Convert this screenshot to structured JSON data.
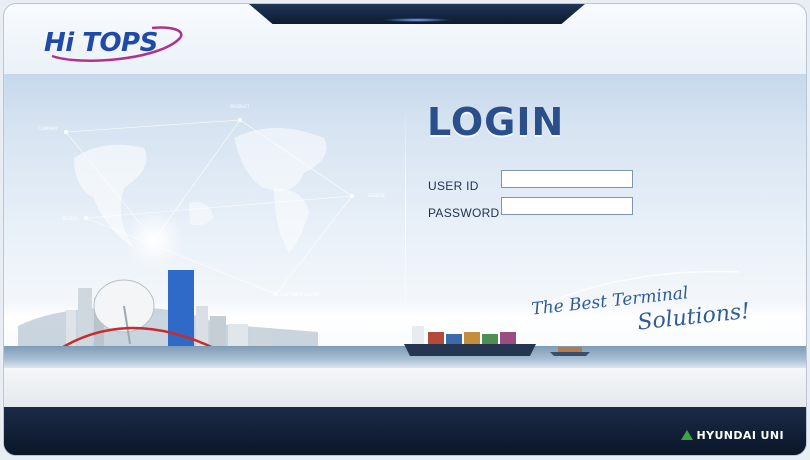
{
  "logo": {
    "text": "Hi TOPS"
  },
  "login": {
    "title": "LOGIN",
    "user_id_label": "USER ID",
    "password_label": "PASSWORD",
    "user_id_value": "",
    "password_value": ""
  },
  "map_labels": {
    "company": "COMPANY",
    "product": "PRODUCT",
    "service": "SERVICE",
    "search": "SEARCH",
    "customer": "CUSTOMER CENTER"
  },
  "slogan": {
    "line1": "The Best Terminal",
    "line2": "Solutions!"
  },
  "footer": {
    "brand": "HYUNDAI UNI"
  },
  "colors": {
    "accent": "#2a4f8a",
    "footer_bg": "#0b1629",
    "logo_blue": "#1f4aa8",
    "logo_magenta": "#b0338a"
  }
}
